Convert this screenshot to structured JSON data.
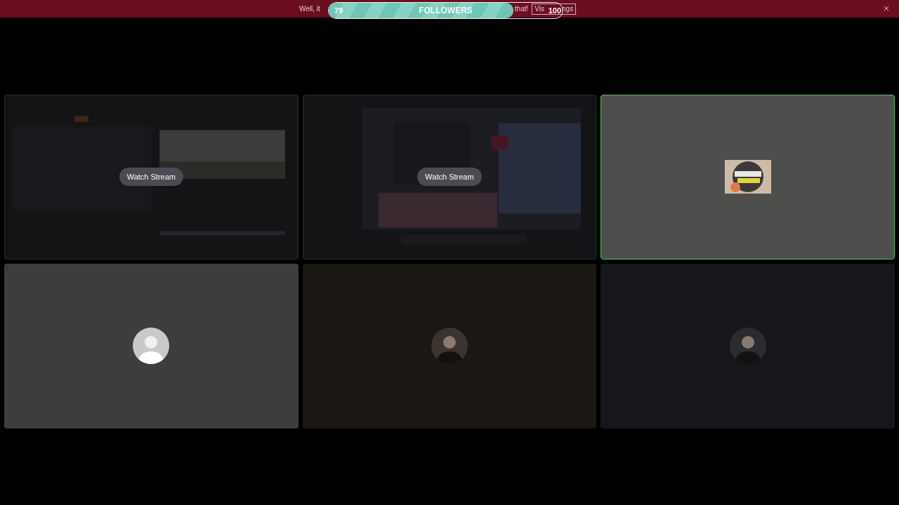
{
  "banner": {
    "text_start": "Well, it",
    "text_end": "that!",
    "button_parts": [
      "Vis",
      "ngs"
    ]
  },
  "followers_goal": {
    "current": "79",
    "label": "FOLLOWERS",
    "target": "100",
    "level": 0.79
  },
  "tiles": [
    {
      "kind": "stream",
      "action": "Watch Stream",
      "speaking": false,
      "color": "#2a2a2c"
    },
    {
      "kind": "stream",
      "action": "Watch Stream",
      "speaking": false,
      "color": "#2a2a2c"
    },
    {
      "kind": "logo",
      "speaking": true,
      "color": "#4e4e4c"
    },
    {
      "kind": "avatar",
      "speaking": false,
      "color": "#3d3d3d"
    },
    {
      "kind": "avatar",
      "speaking": false,
      "color": "#1b1712"
    },
    {
      "kind": "avatar",
      "speaking": false,
      "color": "#15171a"
    }
  ]
}
